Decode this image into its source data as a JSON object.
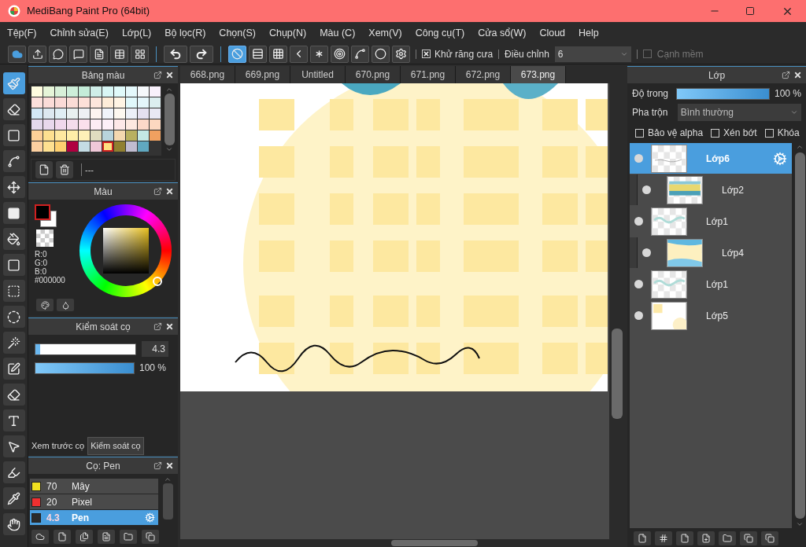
{
  "window": {
    "title": "MediBang Paint Pro (64bit)"
  },
  "menu": [
    "Tệp(F)",
    "Chỉnh sửa(E)",
    "Lớp(L)",
    "Bộ lọc(R)",
    "Chọn(S)",
    "Chụp(N)",
    "Màu (C)",
    "Xem(V)",
    "Công cụ(T)",
    "Cửa sổ(W)",
    "Cloud",
    "Help"
  ],
  "toolbar": {
    "snaps": [
      {
        "kind": "none",
        "selected": true
      },
      {
        "kind": "parallel",
        "selected": false
      },
      {
        "kind": "grid",
        "selected": false
      },
      {
        "kind": "perspective",
        "selected": false
      },
      {
        "kind": "radial",
        "selected": false
      },
      {
        "kind": "concentric",
        "selected": false
      },
      {
        "kind": "curve",
        "selected": false
      },
      {
        "kind": "ellipse",
        "selected": false
      }
    ],
    "antialias": {
      "label": "Khử răng cưa",
      "checked": true
    },
    "correction": {
      "label": "Điều chỉnh",
      "value": "6"
    },
    "soft_edge": {
      "label": "Cạnh mềm",
      "checked": false,
      "disabled": true
    }
  },
  "tools": [
    {
      "kind": "brush",
      "selected": true
    },
    {
      "kind": "eraser",
      "selected": false
    },
    {
      "kind": "dot",
      "selected": false
    },
    {
      "kind": "line",
      "selected": false
    },
    {
      "kind": "move",
      "selected": false
    },
    {
      "kind": "fill",
      "selected": false
    },
    {
      "kind": "bucket",
      "selected": false
    },
    {
      "kind": "gradient",
      "selected": false
    },
    {
      "kind": "select",
      "selected": false
    },
    {
      "kind": "lasso",
      "selected": false
    },
    {
      "kind": "wand",
      "selected": false
    },
    {
      "kind": "select_pen",
      "selected": false
    },
    {
      "kind": "select_eraser",
      "selected": false
    },
    {
      "kind": "text",
      "selected": false
    },
    {
      "kind": "operation",
      "selected": false
    },
    {
      "kind": "blur",
      "selected": false
    },
    {
      "kind": "eyedropper",
      "selected": false
    },
    {
      "kind": "hand",
      "selected": false
    }
  ],
  "tabs": [
    {
      "label": "668.png",
      "selected": false
    },
    {
      "label": "669.png",
      "selected": false
    },
    {
      "label": "Untitled",
      "selected": false
    },
    {
      "label": "670.png",
      "selected": false
    },
    {
      "label": "671.png",
      "selected": false
    },
    {
      "label": "672.png",
      "selected": false
    },
    {
      "label": "673.png",
      "selected": true
    }
  ],
  "palette": {
    "title": "Bảng màu",
    "name": "---",
    "swatches": [
      {
        "color": "#fffde0",
        "selected": false
      },
      {
        "color": "#e6f5d8",
        "selected": false
      },
      {
        "color": "#d8f0d8",
        "selected": false
      },
      {
        "color": "#cdeed9",
        "selected": false
      },
      {
        "color": "#c4ecd8",
        "selected": false
      },
      {
        "color": "#cfeee8",
        "selected": false
      },
      {
        "color": "#d8f6f5",
        "selected": false
      },
      {
        "color": "#e0fafa",
        "selected": false
      },
      {
        "color": "#e4f8fb",
        "selected": false
      },
      {
        "color": "#f5f8fb",
        "selected": false
      },
      {
        "color": "#f8f0fb",
        "selected": false
      },
      {
        "color": "#fde0dc",
        "selected": false
      },
      {
        "color": "#fbdcd8",
        "selected": false
      },
      {
        "color": "#fadad6",
        "selected": false
      },
      {
        "color": "#fadcd6",
        "selected": false
      },
      {
        "color": "#fde0d8",
        "selected": false
      },
      {
        "color": "#fde6dc",
        "selected": false
      },
      {
        "color": "#fdecd8",
        "selected": false
      },
      {
        "color": "#fff4e4",
        "selected": false
      },
      {
        "color": "#e0f8fb",
        "selected": false
      },
      {
        "color": "#e4f6fb",
        "selected": false
      },
      {
        "color": "#dceef0",
        "selected": false
      },
      {
        "color": "#d4e8f6",
        "selected": false
      },
      {
        "color": "#dde8f0",
        "selected": false
      },
      {
        "color": "#e0eef4",
        "selected": false
      },
      {
        "color": "#e8f0f0",
        "selected": false
      },
      {
        "color": "#eef0f4",
        "selected": false
      },
      {
        "color": "#fdf4f0",
        "selected": false
      },
      {
        "color": "#f0f4fa",
        "selected": false
      },
      {
        "color": "#fdf8f0",
        "selected": false
      },
      {
        "color": "#ecf0f8",
        "selected": false
      },
      {
        "color": "#e4e0f0",
        "selected": false
      },
      {
        "color": "#e8e8f4",
        "selected": false
      },
      {
        "color": "#e4d8ec",
        "selected": false
      },
      {
        "color": "#e8d8ec",
        "selected": false
      },
      {
        "color": "#f0d8ec",
        "selected": false
      },
      {
        "color": "#f4dcec",
        "selected": false
      },
      {
        "color": "#fae0ec",
        "selected": false
      },
      {
        "color": "#fcecf4",
        "selected": false
      },
      {
        "color": "#fdf0f8",
        "selected": false
      },
      {
        "color": "#fde8e8",
        "selected": false
      },
      {
        "color": "#fde8e0",
        "selected": false
      },
      {
        "color": "#fcd8c8",
        "selected": false
      },
      {
        "color": "#fcd8c0",
        "selected": false
      },
      {
        "color": "#fdd098",
        "selected": false
      },
      {
        "color": "#fee090",
        "selected": false
      },
      {
        "color": "#fee8a0",
        "selected": false
      },
      {
        "color": "#feeea8",
        "selected": false
      },
      {
        "color": "#fef0b8",
        "selected": false
      },
      {
        "color": "#e0dcc0",
        "selected": false
      },
      {
        "color": "#b8d4dc",
        "selected": false
      },
      {
        "color": "#f4d8b0",
        "selected": false
      },
      {
        "color": "#b8b060",
        "selected": false
      },
      {
        "color": "#c4e8e4",
        "selected": false
      },
      {
        "color": "#f0a060",
        "selected": false
      },
      {
        "color": "#fcd0a0",
        "selected": false
      },
      {
        "color": "#fee090",
        "selected": false
      },
      {
        "color": "#fed070",
        "selected": false
      },
      {
        "color": "#b00040",
        "selected": false
      },
      {
        "color": "#c4dce4",
        "selected": false
      },
      {
        "color": "#f0c8d8",
        "selected": false
      },
      {
        "color": "#fee080",
        "selected": true
      },
      {
        "color": "#908030",
        "selected": false
      },
      {
        "color": "#c0bcd0",
        "selected": false
      },
      {
        "color": "#60a8c0",
        "selected": false
      }
    ]
  },
  "color": {
    "title": "Màu",
    "r": "R:0",
    "g": "G:0",
    "b": "B:0",
    "hex": "#000000"
  },
  "brush_control": {
    "title": "Kiểm soát cọ",
    "size": {
      "level": 0.03,
      "value": "4.3"
    },
    "opacity": {
      "level": 1,
      "reading": "100 %"
    }
  },
  "brush_tabs": [
    {
      "label": "Xem trước cọ",
      "selected": false
    },
    {
      "label": "Kiểm soát cọ",
      "selected": true
    }
  ],
  "brushes": {
    "title": "Cọ: Pen",
    "items": [
      {
        "color": "#f0e020",
        "size": "70",
        "name": "Mây",
        "selected": false
      },
      {
        "color": "#f03030",
        "size": "20",
        "name": "Pixel",
        "selected": false
      },
      {
        "color": "#2a2a2a",
        "size": "4.3",
        "name": "Pen",
        "selected": true
      }
    ]
  },
  "layers": {
    "title": "Lớp",
    "opacity": {
      "label": "Độ trong",
      "level": 1,
      "reading": "100 %"
    },
    "blend": {
      "label": "Pha trộn",
      "value": "Bình thường"
    },
    "options": [
      {
        "label": "Bảo vệ alpha",
        "checked": false
      },
      {
        "label": "Xén bớt",
        "checked": false
      },
      {
        "label": "Khóa",
        "checked": false
      }
    ],
    "items": [
      {
        "name": "Lớp6",
        "selected": true,
        "clipped": false
      },
      {
        "name": "Lớp2",
        "selected": false,
        "clipped": true
      },
      {
        "name": "Lớp1",
        "selected": false,
        "clipped": false
      },
      {
        "name": "Lớp4",
        "selected": false,
        "clipped": true
      },
      {
        "name": "Lớp1",
        "selected": false,
        "clipped": false
      },
      {
        "name": "Lớp5",
        "selected": false,
        "clipped": false
      }
    ]
  }
}
